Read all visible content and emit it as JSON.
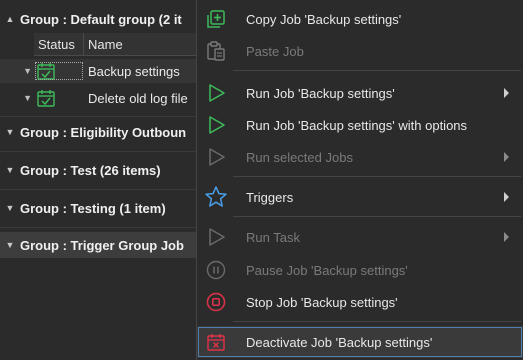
{
  "grid": {
    "groups": [
      {
        "label": "Group : Default group (2 it",
        "expanded": true
      },
      {
        "label": "Group : Eligibility Outboun",
        "expanded": false
      },
      {
        "label": "Group : Test (26 items)",
        "expanded": false
      },
      {
        "label": "Group : Testing (1 item)",
        "expanded": false
      },
      {
        "label": "Group : Trigger Group Job",
        "expanded": false
      }
    ],
    "columns": {
      "status": "Status",
      "name": "Name"
    },
    "jobs": [
      {
        "name": "Backup settings",
        "status_icon": "calendar-check-icon",
        "selected": true
      },
      {
        "name": "Delete old log file",
        "status_icon": "calendar-check-icon",
        "selected": false
      }
    ]
  },
  "menu": {
    "items": [
      {
        "label": "Copy Job 'Backup settings'",
        "icon": "copy-add-icon",
        "enabled": true,
        "submenu": false
      },
      {
        "label": "Paste Job",
        "icon": "paste-icon",
        "enabled": false,
        "submenu": false
      },
      {
        "label": "Run Job 'Backup settings'",
        "icon": "play-icon",
        "enabled": true,
        "submenu": true
      },
      {
        "label": "Run Job 'Backup settings' with options",
        "icon": "play-icon",
        "enabled": true,
        "submenu": false
      },
      {
        "label": "Run selected Jobs",
        "icon": "play-icon",
        "enabled": false,
        "submenu": true
      },
      {
        "label": "Triggers",
        "icon": "star-icon",
        "enabled": true,
        "submenu": true
      },
      {
        "label": "Run Task",
        "icon": "play-icon",
        "enabled": false,
        "submenu": true
      },
      {
        "label": "Pause Job 'Backup settings'",
        "icon": "pause-icon",
        "enabled": false,
        "submenu": false
      },
      {
        "label": "Stop Job 'Backup settings'",
        "icon": "stop-icon",
        "enabled": true,
        "submenu": false
      },
      {
        "label": "Deactivate Job 'Backup settings'",
        "icon": "calendar-x-icon",
        "enabled": true,
        "submenu": false,
        "highlighted": true
      }
    ]
  },
  "colors": {
    "background": "#252526",
    "menu_background": "#2b2b2b",
    "accent_green": "#3dbb5a",
    "accent_blue": "#4a9fe8",
    "accent_red": "#e0334a",
    "disabled_text": "#7a7a7a"
  }
}
